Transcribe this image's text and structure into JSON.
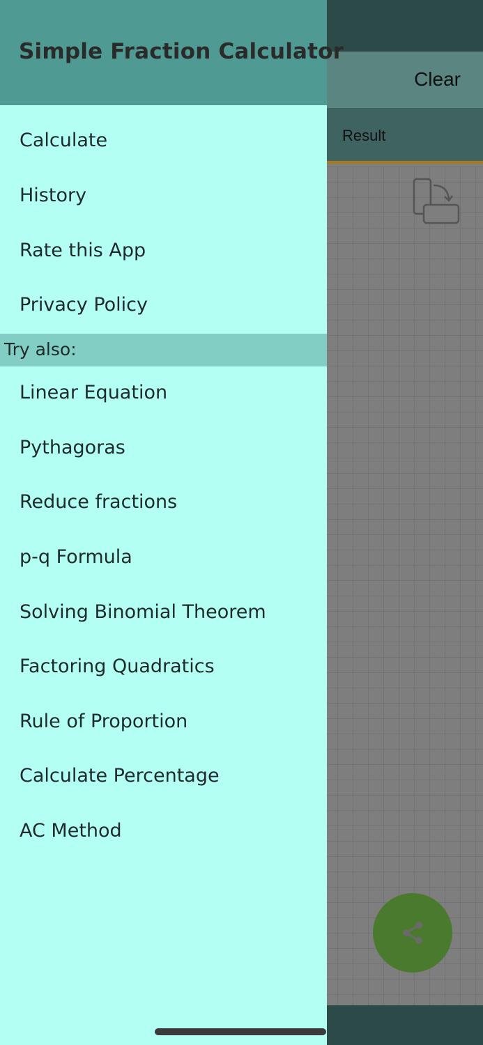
{
  "background": {
    "toolbar": {
      "clear_label": "Clear"
    },
    "tabs": {
      "result_label": "Result"
    }
  },
  "drawer": {
    "title": "Simple Fraction Calculator",
    "main_items": [
      {
        "label": "Calculate"
      },
      {
        "label": "History"
      },
      {
        "label": "Rate this App"
      },
      {
        "label": "Privacy Policy"
      }
    ],
    "section_label": "Try also:",
    "try_items": [
      {
        "label": "Linear Equation"
      },
      {
        "label": "Pythagoras"
      },
      {
        "label": "Reduce fractions"
      },
      {
        "label": "p-q Formula"
      },
      {
        "label": "Solving Binomial Theorem"
      },
      {
        "label": "Factoring Quadratics"
      },
      {
        "label": "Rule of Proportion"
      },
      {
        "label": "Calculate Percentage"
      },
      {
        "label": "AC Method"
      }
    ]
  },
  "colors": {
    "drawer_bg": "#b3fff4",
    "drawer_header": "#4f9b94",
    "section_bar": "#82cdc4",
    "fab": "#4a7a2e"
  },
  "icons": {
    "rotate": "rotate-device-icon",
    "share": "share-icon"
  }
}
